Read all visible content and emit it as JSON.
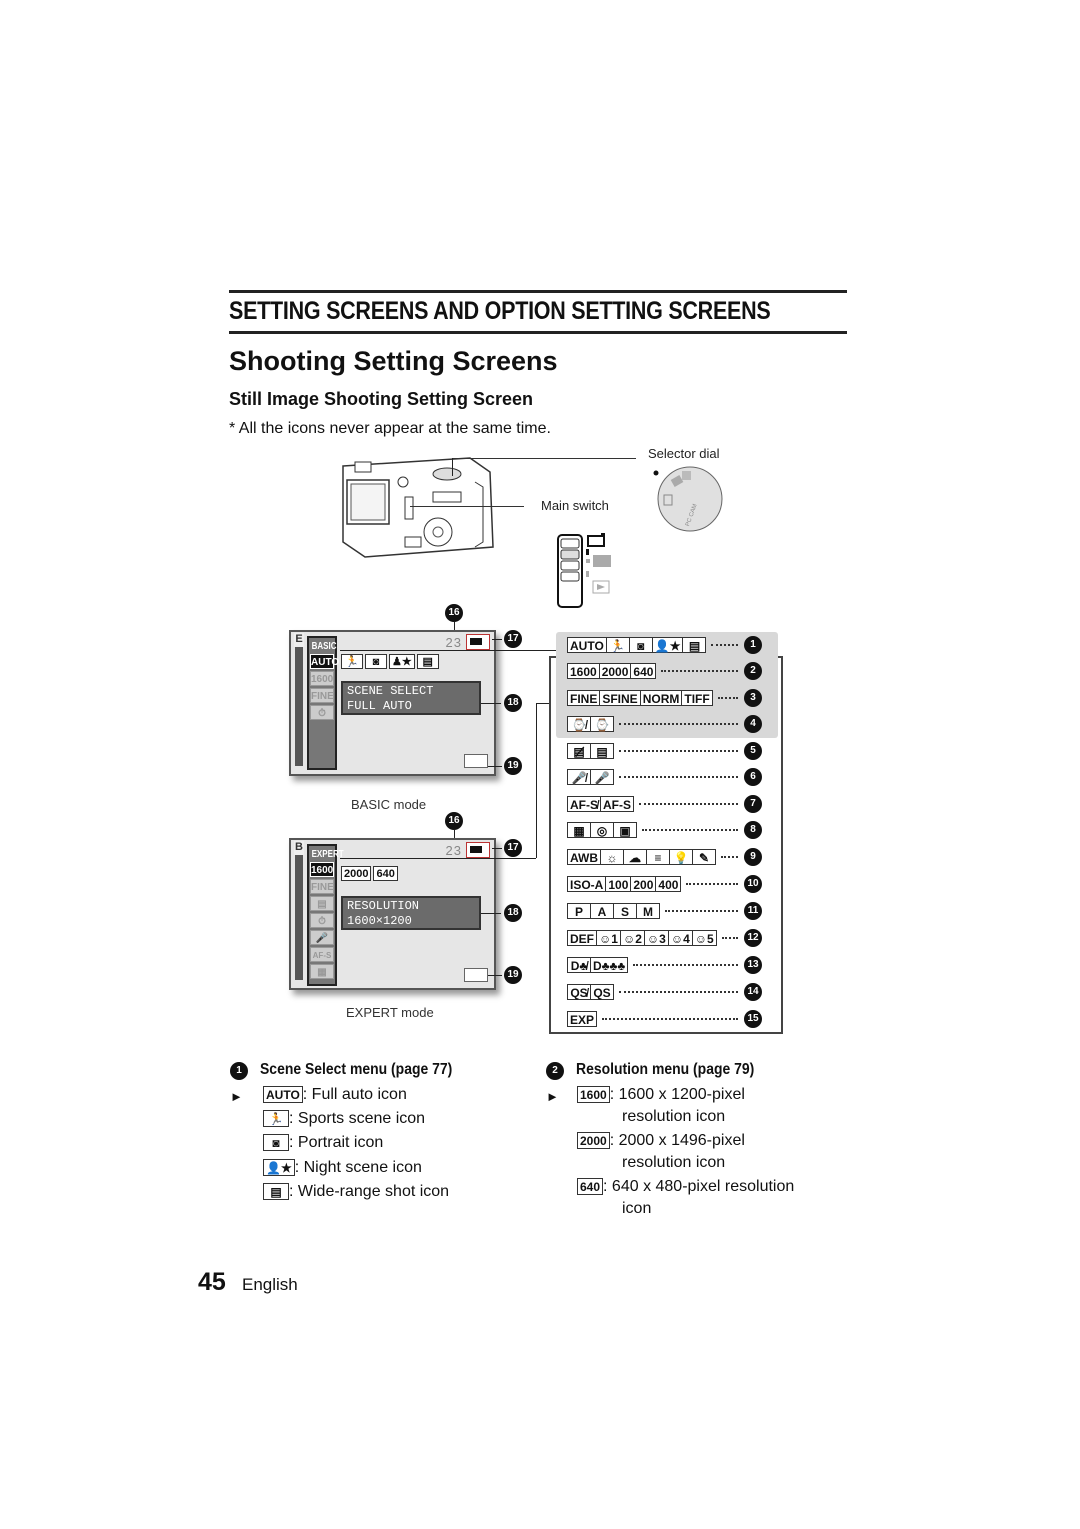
{
  "section_title": "SETTING SCREENS AND OPTION SETTING SCREENS",
  "heading": "Shooting Setting Screens",
  "subheading": "Still Image Shooting Setting Screen",
  "note": "*  All the icons never appear at the same time.",
  "camera": {
    "selector_dial_label": "Selector dial",
    "main_switch_label": "Main switch",
    "dial_marks": [
      "PC CAM"
    ]
  },
  "basic_screen": {
    "caption": "BASIC mode",
    "side_letter": "E",
    "mode_label": "BASIC",
    "menu_cells": [
      "AUTO",
      "1600",
      "FINE",
      "self-timer"
    ],
    "active_cell": "AUTO",
    "shot_count": "23",
    "scene_icons": [
      "sports-icon",
      "portrait-icon",
      "night-scene-icon",
      "wide-range-icon"
    ],
    "banner_line1": "SCENE SELECT",
    "banner_line2": "FULL AUTO"
  },
  "expert_screen": {
    "caption": "EXPERT mode",
    "side_letter": "B",
    "mode_label": "EXPERT",
    "menu_cells": [
      "1600",
      "FINE",
      "wide-range",
      "self-timer",
      "mic",
      "AF-S",
      "grid"
    ],
    "active_cell": "1600",
    "shot_count": "23",
    "res_tiles": [
      "2000",
      "640"
    ],
    "banner_line1": "RESOLUTION",
    "banner_line2": "1600×1200"
  },
  "callout_numbers": {
    "n16": "16",
    "n17": "17",
    "n18": "18",
    "n19": "19"
  },
  "legend_rows": [
    {
      "num": "1",
      "tiles": [
        "AUTO",
        "🏃",
        "◙",
        "👤★",
        "▤"
      ]
    },
    {
      "num": "2",
      "tiles": [
        "1600",
        "2000",
        "640"
      ]
    },
    {
      "num": "3",
      "tiles": [
        "FINE",
        "SFINE",
        "NORM",
        "TIFF"
      ]
    },
    {
      "num": "4",
      "tiles": [
        "⌚̸",
        "⌚"
      ]
    },
    {
      "num": "5",
      "tiles": [
        "▤̸",
        "▤"
      ]
    },
    {
      "num": "6",
      "tiles": [
        "🎤̸",
        "🎤"
      ]
    },
    {
      "num": "7",
      "tiles": [
        "AF-S̸",
        "AF-S"
      ]
    },
    {
      "num": "8",
      "tiles": [
        "▦",
        "◎",
        "▣"
      ]
    },
    {
      "num": "9",
      "tiles": [
        "AWB",
        "☼",
        "☁",
        "≡",
        "💡",
        "✎"
      ]
    },
    {
      "num": "10",
      "tiles": [
        "ISO-A",
        "100",
        "200",
        "400"
      ]
    },
    {
      "num": "11",
      "tiles": [
        "P",
        "A",
        "S",
        "M"
      ]
    },
    {
      "num": "12",
      "tiles": [
        "DEF",
        "☺1",
        "☺2",
        "☺3",
        "☺4",
        "☺5"
      ]
    },
    {
      "num": "13",
      "tiles": [
        "D♣̸",
        "D♣♣♣"
      ]
    },
    {
      "num": "14",
      "tiles": [
        "QS̸",
        "QS"
      ]
    },
    {
      "num": "15",
      "tiles": [
        "EXP"
      ]
    }
  ],
  "scene_menu": {
    "num": "1",
    "title": "Scene Select menu (page 77)",
    "items": [
      {
        "icon": "AUTO",
        "text": ": Full auto icon",
        "default": true
      },
      {
        "icon": "🏃",
        "text": ": Sports scene icon"
      },
      {
        "icon": "◙",
        "text": ": Portrait icon"
      },
      {
        "icon": "👤★",
        "text": ": Night scene icon"
      },
      {
        "icon": "▤",
        "text": ": Wide-range shot icon"
      }
    ]
  },
  "resolution_menu": {
    "num": "2",
    "title": "Resolution menu (page 79)",
    "items": [
      {
        "icon": "1600",
        "line1": ": 1600 x 1200-pixel",
        "line2": "resolution icon",
        "default": true
      },
      {
        "icon": "2000",
        "line1": ": 2000 x 1496-pixel",
        "line2": "resolution icon"
      },
      {
        "icon": "640",
        "line1": ": 640 x 480-pixel resolution",
        "line2": "icon"
      }
    ]
  },
  "default_marker": "►",
  "footer": {
    "page_number": "45",
    "language": "English"
  }
}
